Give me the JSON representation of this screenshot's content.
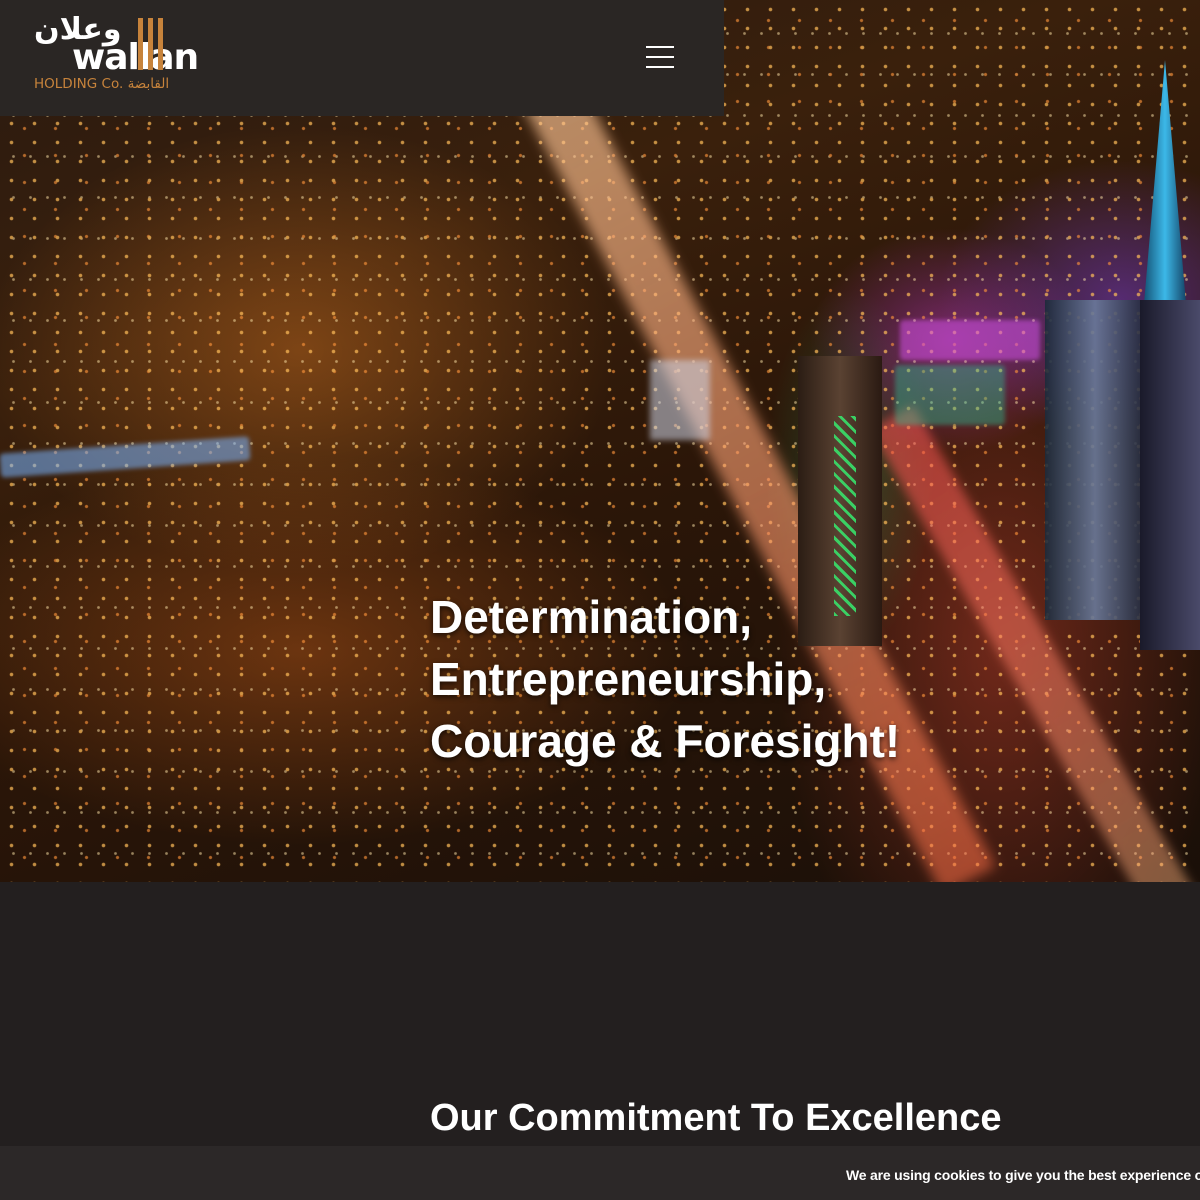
{
  "header": {
    "logo": {
      "arabic": "وعلان",
      "latin": "wallan",
      "subtitle": "HOLDING Co. القابضة"
    },
    "menu_icon": "hamburger-menu-icon"
  },
  "hero": {
    "lines": [
      "Determination,",
      "Entrepreneurship,",
      "Courage & Foresight!"
    ]
  },
  "sections": {
    "commitment_title": "Our Commitment To Excellence"
  },
  "cookie_bar": {
    "text": "We are using cookies to give you the best experience o"
  },
  "colors": {
    "brand_accent": "#c7833b",
    "header_bg": "#2a2624",
    "page_bg": "#231f1f"
  }
}
